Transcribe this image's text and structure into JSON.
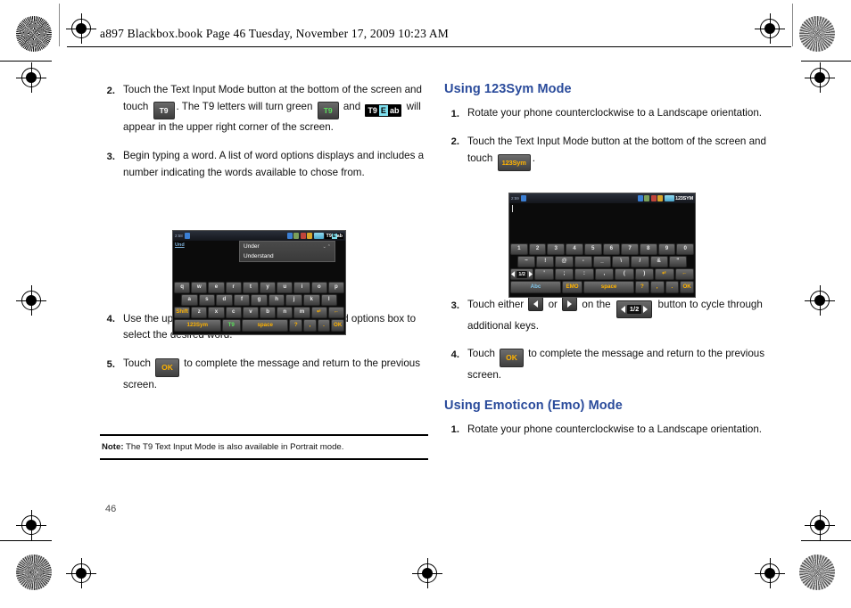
{
  "header": {
    "text": "a897 Blackbox.book  Page 46  Tuesday, November 17, 2009  10:23 AM"
  },
  "page_number": "46",
  "left_column": {
    "steps": [
      {
        "num": "2.",
        "parts": [
          {
            "type": "text",
            "value": "Touch the Text Input Mode button at the bottom of the screen and touch "
          },
          {
            "type": "chip",
            "style": "t9",
            "value": "T9"
          },
          {
            "type": "text",
            "value": ". The T9 letters will turn green "
          },
          {
            "type": "chip",
            "style": "t9green",
            "value": "T9"
          },
          {
            "type": "text",
            "value": " and "
          },
          {
            "type": "chip",
            "style": "t9eab",
            "value": "T9Eab"
          },
          {
            "type": "text",
            "value": " will appear in the upper right corner of the screen."
          }
        ],
        "text": "Touch the Text Input Mode button at the bottom of the screen and touch T9 . The T9 letters will turn green T9 and T9Eab will appear in the upper right corner of the screen."
      },
      {
        "num": "3.",
        "text": "Begin typing a word. A list of word options displays and includes a number indicating the words available to chose from."
      },
      {
        "num": "4.",
        "text": "Use the up and down navigation keys in the word options box to select the desired word."
      },
      {
        "num": "5.",
        "pre": "Touch ",
        "chip": "OK",
        "post": " to complete the message and return to the previous screen."
      }
    ],
    "note": {
      "label": "Note:",
      "text": " The T9 Text Input Mode is also available in Portrait mode."
    }
  },
  "right_column": {
    "section_1": {
      "heading": "Using 123Sym Mode",
      "steps": [
        {
          "num": "1.",
          "text": "Rotate your phone counterclockwise to a Landscape orientation."
        },
        {
          "num": "2.",
          "pre": "Touch the Text Input Mode button at the bottom of the screen and touch ",
          "chip": "123Sym",
          "post": "."
        },
        {
          "num": "3.",
          "pre": "Touch either ",
          "mid1": " or ",
          "mid2": " on the ",
          "half_label": "1/2",
          "post": " button to cycle through additional keys."
        },
        {
          "num": "4.",
          "pre": "Touch ",
          "chip": "OK",
          "post": " to complete the message and return to the previous screen."
        }
      ]
    },
    "section_2": {
      "heading": "Using Emoticon (Emo) Mode",
      "steps": [
        {
          "num": "1.",
          "text": "Rotate your phone counterclockwise to a Landscape orientation."
        }
      ]
    }
  },
  "screenshot_qwerty": {
    "status_left": "2:58",
    "status_mode_t9": "T9",
    "status_mode_e": "E",
    "status_mode_ab": "ab",
    "input_label": "Und",
    "word_options": [
      "Under",
      "Understand"
    ],
    "rows": [
      [
        "q",
        "w",
        "e",
        "r",
        "t",
        "y",
        "u",
        "i",
        "o",
        "p"
      ],
      [
        "a",
        "s",
        "d",
        "f",
        "g",
        "h",
        "j",
        "k",
        "l"
      ],
      [
        "Shift",
        "z",
        "x",
        "c",
        "v",
        "b",
        "n",
        "m",
        "↵",
        "←"
      ],
      [
        "123Sym",
        "T9",
        "space",
        "?",
        ",",
        ".",
        "OK"
      ]
    ]
  },
  "screenshot_123sym": {
    "status_left": "2:59",
    "status_mode": "123SYM",
    "rows": [
      [
        "1",
        "2",
        "3",
        "4",
        "5",
        "6",
        "7",
        "8",
        "9",
        "0"
      ],
      [
        "~",
        "!",
        "@",
        "-",
        "_",
        "\\",
        "/",
        "&",
        "\""
      ],
      [
        "1/2",
        "'",
        ";",
        ":",
        ",",
        "(",
        ")",
        "↵",
        "←"
      ],
      [
        "Abc",
        "EMO",
        "space",
        "?",
        ",",
        ".",
        "OK"
      ]
    ]
  },
  "colors": {
    "heading_blue": "#2a4b9b",
    "key_amber": "#ffb300",
    "key_green": "#5ce05c",
    "key_blue": "#7fc4e8",
    "t9_cyan": "#7fe0ef"
  }
}
